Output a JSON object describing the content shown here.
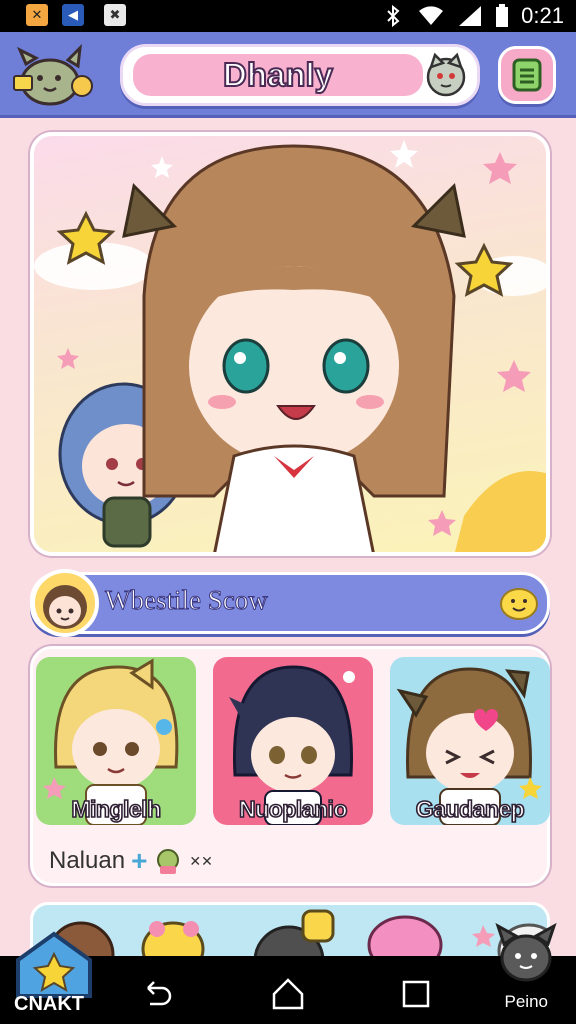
{
  "status_bar": {
    "time": "0:21",
    "apps": [
      "app-icon-a",
      "app-icon-b",
      "app-icon-c"
    ]
  },
  "header": {
    "title": "Dhanly"
  },
  "section": {
    "title": "Wbestile Scow"
  },
  "characters": [
    {
      "name": "Minglelh",
      "bg": "#9edc7c"
    },
    {
      "name": "Nuoplanio",
      "bg": "#f26b8f"
    },
    {
      "name": "Gaudanep",
      "bg": "#a9e0ef"
    }
  ],
  "panel_footer": {
    "label": "Naluan"
  },
  "nav": {
    "start_label": "CNAKT",
    "right_label": "Peino"
  },
  "colors": {
    "header": "#6f7fd8",
    "accent_pink": "#f7a9c8",
    "banner": "#7d8ae0",
    "background": "#f9dde3"
  }
}
